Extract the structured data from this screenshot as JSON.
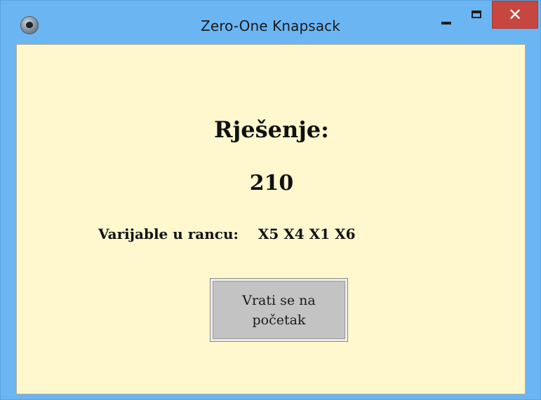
{
  "window": {
    "title": "Zero-One Knapsack",
    "app_icon": "app-logo-icon",
    "controls": {
      "minimize": "minimize-icon",
      "maximize": "maximize-icon",
      "close_symbol": "✕"
    }
  },
  "result": {
    "heading": "Rješenje:",
    "value": "210",
    "variables_label": "Varijable u rancu:",
    "variables_values": "X5 X4 X1 X6"
  },
  "actions": {
    "back_label": "Vrati se na početak"
  },
  "colors": {
    "titlebar": "#6bb5f3",
    "client_background": "#fff8cf",
    "close_button": "#c7463f",
    "button_face": "#c3c3c3"
  }
}
